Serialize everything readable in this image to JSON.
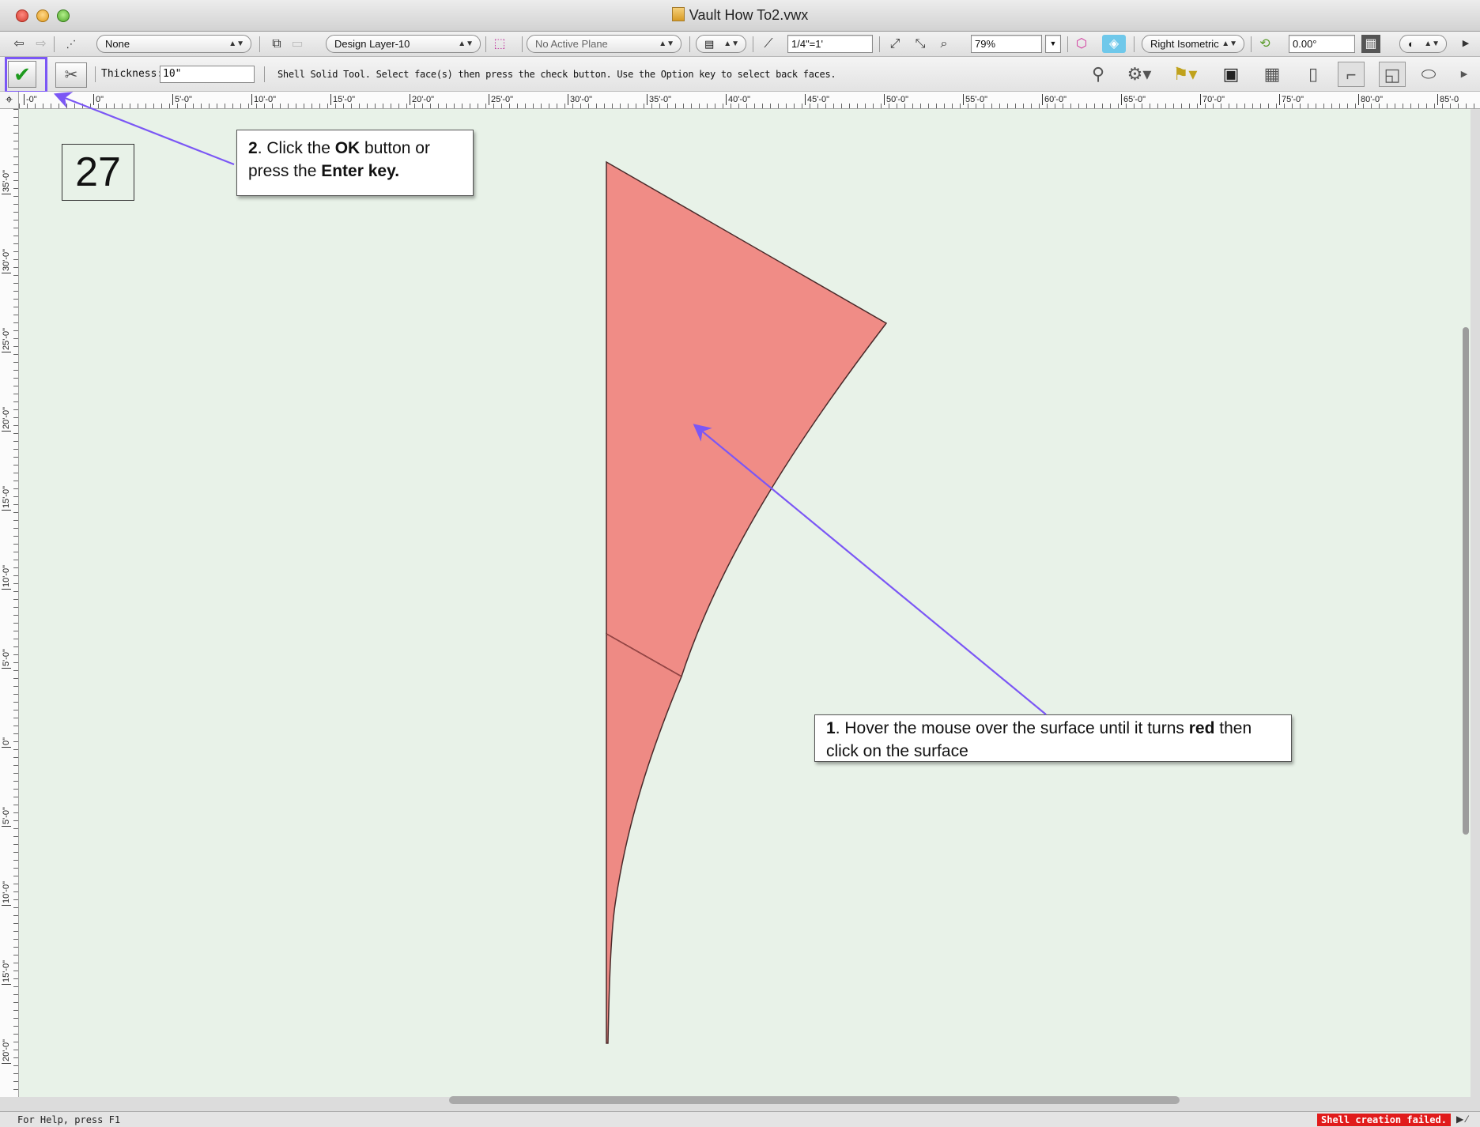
{
  "window": {
    "title": "Vault How To2.vwx"
  },
  "view_bar": {
    "class_popup": "None",
    "layer_popup": "Design Layer-10",
    "plane_popup": "No Active Plane",
    "scale_field": "1/4\"=1'",
    "zoom_field": "79%",
    "view_popup": "Right Isometric",
    "rotation_field": "0.00°"
  },
  "mode_bar": {
    "thickness_label": "Thickness:",
    "thickness_value": "10\"",
    "tool_message": "Shell Solid Tool. Select face(s) then press the check button. Use the Option key to select back faces."
  },
  "ruler_h": [
    "-0\"",
    "0\"",
    "5'-0\"",
    "10'-0\"",
    "15'-0\"",
    "20'-0\"",
    "25'-0\"",
    "30'-0\"",
    "35'-0\"",
    "40'-0\"",
    "45'-0\"",
    "50'-0\"",
    "55'-0\"",
    "60'-0\"",
    "65'-0\"",
    "70'-0\"",
    "75'-0\"",
    "80'-0\"",
    "85'-0"
  ],
  "ruler_v": [
    "35'-0\"",
    "30'-0\"",
    "25'-0\"",
    "20'-0\"",
    "15'-0\"",
    "10'-0\"",
    "5'-0\"",
    "0\"",
    "5'-0\"",
    "10'-0\"",
    "15'-0\"",
    "20'-0\""
  ],
  "step_number": "27",
  "callout_2": {
    "num": "2",
    "t1": ". Click the ",
    "b1": "OK",
    "t2": " button or press the ",
    "b2": "Enter key."
  },
  "callout_1": {
    "num": "1",
    "t1": ". Hover the mouse over the surface until it turns ",
    "b1": "red",
    "t2": " then click on the surface"
  },
  "status": {
    "help": "For Help, press F1",
    "error": "Shell creation failed."
  },
  "colors": {
    "canvas": "#e8f2e8",
    "surface_highlight": "#f08c86",
    "callout_arrow": "#7b57f5",
    "error": "#e11b1b"
  },
  "icons": {
    "ok": "checkmark-icon",
    "options": "tools-options-icon"
  }
}
